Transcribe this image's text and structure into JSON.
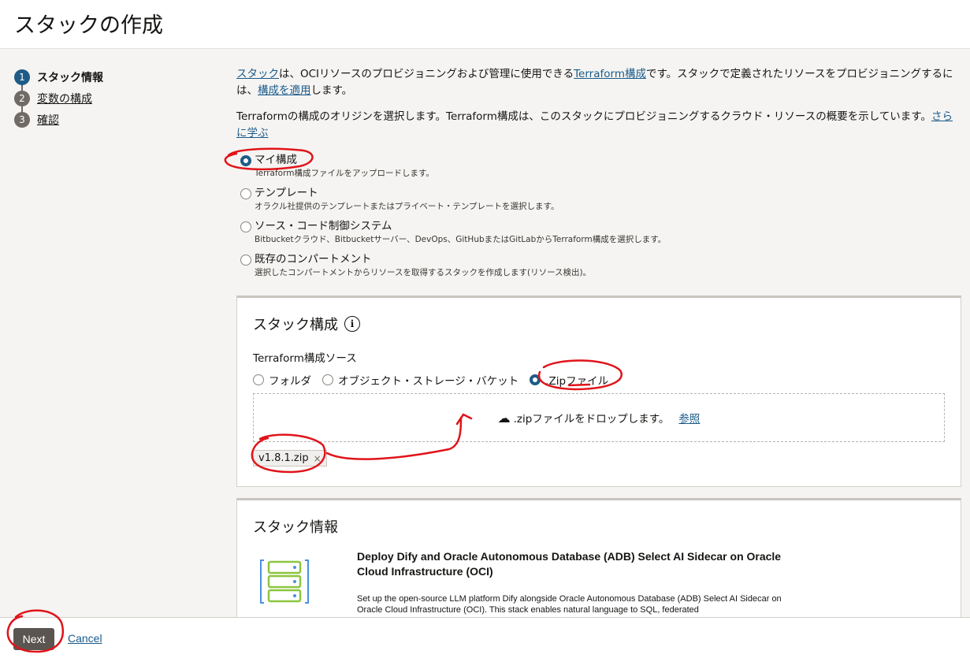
{
  "header": {
    "title": "スタックの作成"
  },
  "steps": [
    {
      "num": "1",
      "label": "スタック情報"
    },
    {
      "num": "2",
      "label": "変数の構成"
    },
    {
      "num": "3",
      "label": "確認"
    }
  ],
  "intro": {
    "link1": "スタック",
    "text1": "は、OCIリソースのプロビジョニングおよび管理に使用できる",
    "link2": "Terraform構成",
    "text2": "です。スタックで定義されたリソースをプロビジョニングするには、",
    "link3": "構成を適用",
    "text3": "します。"
  },
  "origin": {
    "text": "Terraformの構成のオリジンを選択します。Terraform構成は、このスタックにプロビジョニングするクラウド・リソースの概要を示しています。",
    "link": "さらに学ぶ"
  },
  "options": [
    {
      "title": "マイ構成",
      "desc": "Terraform構成ファイルをアップロードします。"
    },
    {
      "title": "テンプレート",
      "desc": "オラクル社提供のテンプレートまたはプライベート・テンプレートを選択します。"
    },
    {
      "title": "ソース・コード制御システム",
      "desc": "Bitbucketクラウド、Bitbucketサーバー、DevOps、GitHubまたはGitLabからTerraform構成を選択します。"
    },
    {
      "title": "既存のコンパートメント",
      "desc": "選択したコンパートメントからリソースを取得するスタックを作成します(リソース検出)。"
    }
  ],
  "stack_config": {
    "title": "スタック構成",
    "info_icon": "i",
    "source_label": "Terraform構成ソース",
    "sources": [
      "フォルダ",
      "オブジェクト・ストレージ・バケット",
      ".Zipファイル"
    ],
    "drop_text": ".zipファイルをドロップします。",
    "browse": "参照",
    "file_chip": "v1.8.1.zip",
    "remove": "×"
  },
  "stack_info": {
    "title": "スタック情報",
    "name": "Deploy Dify and Oracle Autonomous Database (ADB) Select AI Sidecar on Oracle Cloud Infrastructure (OCI)",
    "description": "Set up the open-source LLM platform Dify alongside Oracle Autonomous Database (ADB) Select AI Sidecar on Oracle Cloud Infrastructure (OCI). This stack enables natural language to SQL, federated"
  },
  "footer": {
    "next": "Next",
    "cancel": "Cancel"
  },
  "colors": {
    "accent": "#1e5c87",
    "annotation": "#e0141a",
    "icon_blue": "#4a90e2",
    "icon_green": "#8cc63f"
  }
}
